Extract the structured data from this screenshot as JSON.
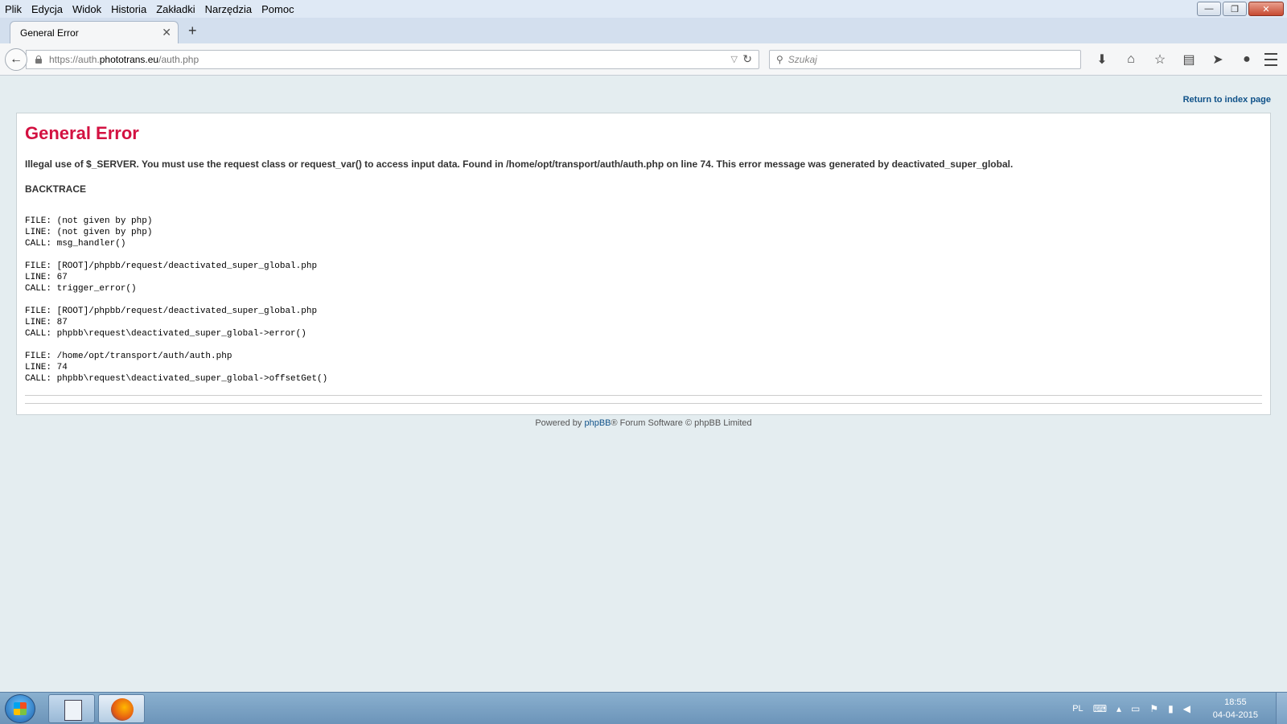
{
  "menu": [
    "Plik",
    "Edycja",
    "Widok",
    "Historia",
    "Zakładki",
    "Narzędzia",
    "Pomoc"
  ],
  "window_controls": {
    "minimize": "—",
    "restore": "❐",
    "close": "✕"
  },
  "tab": {
    "title": "General Error",
    "close": "✕",
    "new_tab": "+"
  },
  "nav": {
    "back": "←",
    "url_prefix": "https://auth.",
    "url_host": "phototrans.eu",
    "url_path": "/auth.php",
    "dropdown": "▽",
    "reload": "↻",
    "search_icon": "⚲",
    "search_placeholder": "Szukaj",
    "icons": {
      "download": "⬇",
      "home": "⌂",
      "bookmark": "☆",
      "reading_list": "▤",
      "pocket": "➤",
      "chat": "●"
    }
  },
  "page": {
    "return_link": "Return to index page",
    "title": "General Error",
    "message": "Illegal use of $_SERVER. You must use the request class or request_var() to access input data. Found in /home/opt/transport/auth/auth.php on line 74. This error message was generated by deactivated_super_global.",
    "backtrace_title": "BACKTRACE",
    "trace": [
      {
        "file": "FILE: (not given by php)",
        "line": "LINE: (not given by php)",
        "call": "CALL: msg_handler()"
      },
      {
        "file": "FILE: [ROOT]/phpbb/request/deactivated_super_global.php",
        "line": "LINE: 67",
        "call": "CALL: trigger_error()"
      },
      {
        "file": "FILE: [ROOT]/phpbb/request/deactivated_super_global.php",
        "line": "LINE: 87",
        "call": "CALL: phpbb\\request\\deactivated_super_global->error()"
      },
      {
        "file": "FILE: /home/opt/transport/auth/auth.php",
        "line": "LINE: 74",
        "call": "CALL: phpbb\\request\\deactivated_super_global->offsetGet()"
      }
    ],
    "footer_pre": "Powered by ",
    "footer_link": "phpBB",
    "footer_post": "® Forum Software © phpBB Limited"
  },
  "taskbar": {
    "lang": "PL",
    "tray_icons": {
      "keyboard": "⌨",
      "up": "▴",
      "monitor": "▭",
      "flag": "⚑",
      "network": "▮",
      "volume": "◀"
    },
    "time": "18:55",
    "date": "04-04-2015"
  }
}
